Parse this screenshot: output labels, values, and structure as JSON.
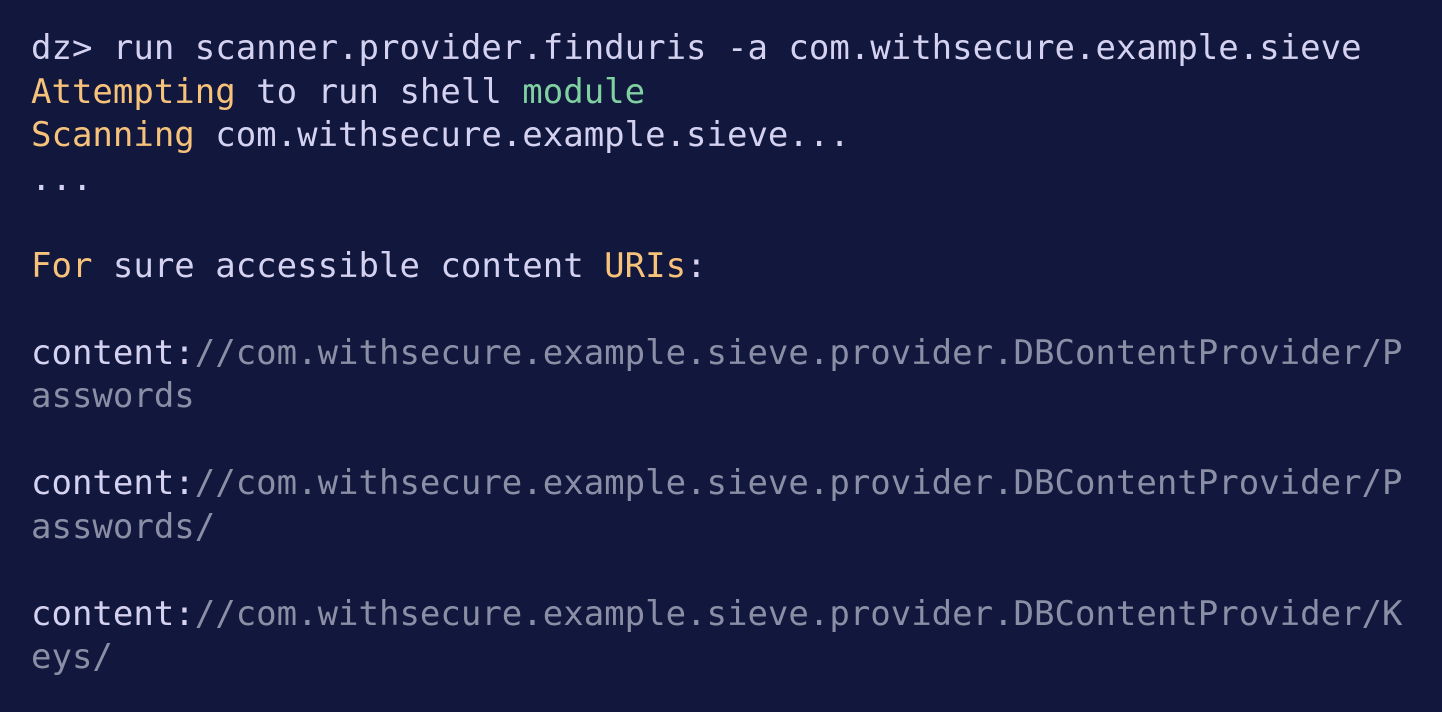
{
  "terminal": {
    "colors": {
      "background": "#12173d",
      "text": "#d4d2f0",
      "keyword": "#f7c27a",
      "module": "#7fd1a1",
      "uri": "#8b8fa6"
    },
    "command": {
      "prompt": "dz> ",
      "text": "run scanner.provider.finduris -a com.withsecure.example.sieve"
    },
    "line_attempting": {
      "word1": "Attempting",
      "mid": " to run shell ",
      "word2": "module"
    },
    "line_scanning": {
      "word": "Scanning",
      "rest": " com.withsecure.example.sieve..."
    },
    "ellipsis": "...",
    "header": {
      "word1": "For",
      "mid": " sure accessible content ",
      "word2": "URIs",
      "colon": ":"
    },
    "uris": [
      {
        "scheme": "content:",
        "line1": "//com.withsecure.example.sieve.provider.DBContentProvider/P",
        "line2": "asswords"
      },
      {
        "scheme": "content:",
        "line1": "//com.withsecure.example.sieve.provider.DBContentProvider/P",
        "line2": "asswords/"
      },
      {
        "scheme": "content:",
        "line1": "//com.withsecure.example.sieve.provider.DBContentProvider/K",
        "line2": "eys/"
      }
    ]
  }
}
